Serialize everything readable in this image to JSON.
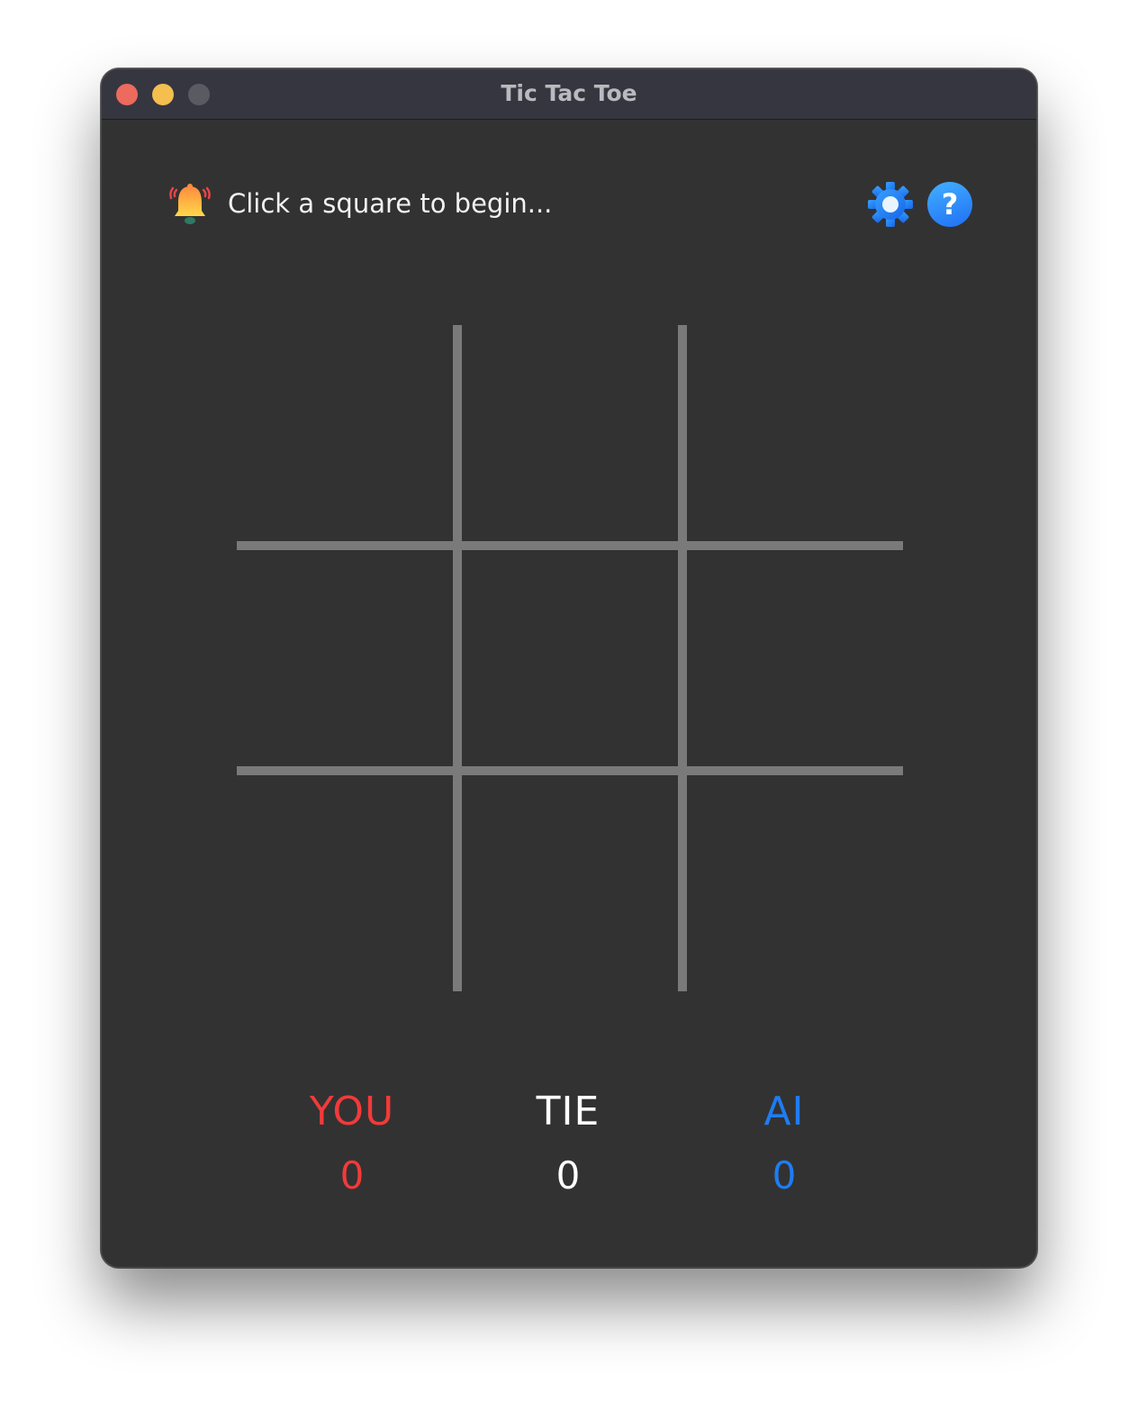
{
  "window": {
    "title": "Tic Tac Toe"
  },
  "status": {
    "message": "Click a square to begin...",
    "icon": "bell-icon"
  },
  "toolbar": {
    "settings_icon": "gear-icon",
    "help_label": "?"
  },
  "colors": {
    "background": "#323232",
    "grid": "#7a7a7a",
    "you": "#f23a3a",
    "tie": "#ffffff",
    "ai": "#1f7cf2",
    "help": "#2a8cf8"
  },
  "board": {
    "cells": [
      "",
      "",
      "",
      "",
      "",
      "",
      "",
      "",
      ""
    ]
  },
  "scores": {
    "you": {
      "label": "YOU",
      "value": "0"
    },
    "tie": {
      "label": "TIE",
      "value": "0"
    },
    "ai": {
      "label": "AI",
      "value": "0"
    }
  }
}
